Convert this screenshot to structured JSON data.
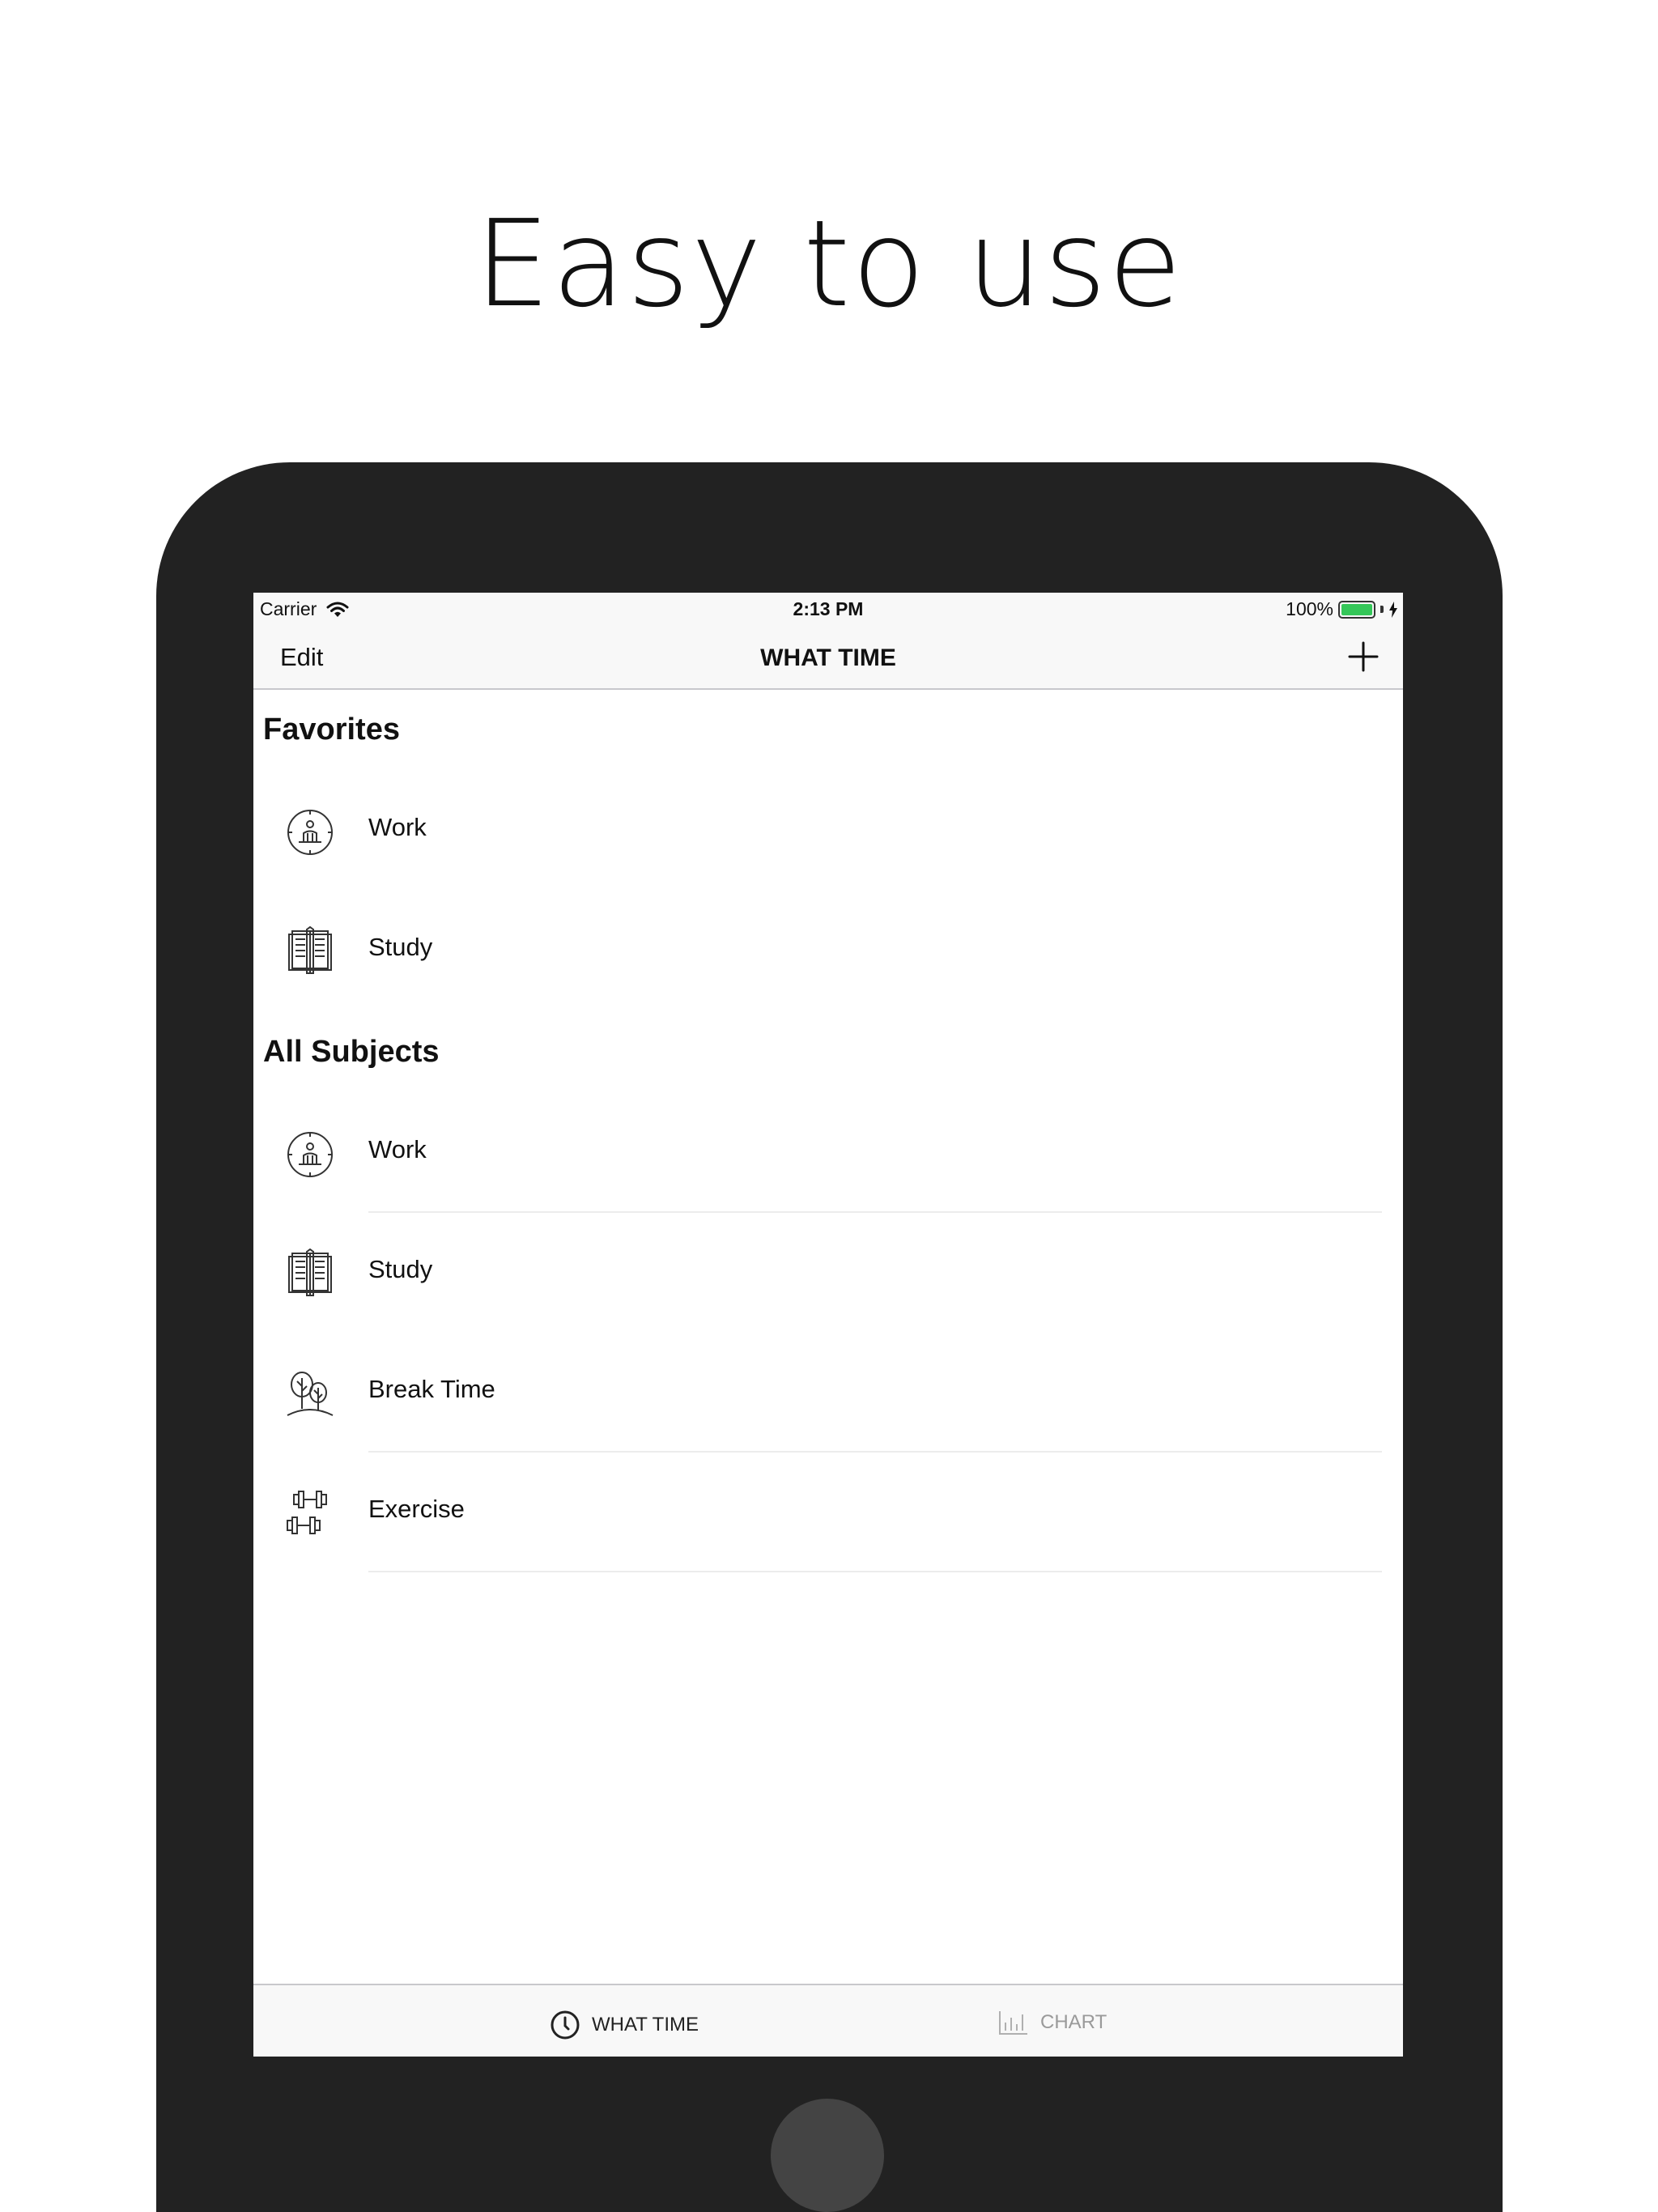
{
  "headline": "Easy to use",
  "status_bar": {
    "carrier": "Carrier",
    "time": "2:13 PM",
    "battery": "100%"
  },
  "nav": {
    "edit_label": "Edit",
    "title": "WHAT TIME",
    "add_icon": "plus-icon"
  },
  "favorites": {
    "header": "Favorites",
    "items": [
      {
        "label": "Work",
        "icon": "clock-person-icon"
      },
      {
        "label": "Study",
        "icon": "book-icon"
      }
    ]
  },
  "all_subjects": {
    "header": "All Subjects",
    "items": [
      {
        "label": "Work",
        "icon": "clock-person-icon"
      },
      {
        "label": "Study",
        "icon": "book-icon"
      },
      {
        "label": "Break Time",
        "icon": "trees-icon"
      },
      {
        "label": "Exercise",
        "icon": "dumbbell-icon"
      }
    ]
  },
  "tabs": [
    {
      "label": "WHAT TIME",
      "icon": "clock-icon",
      "active": true
    },
    {
      "label": "CHART",
      "icon": "bar-chart-icon",
      "active": false
    }
  ],
  "colors": {
    "device": "#222222",
    "battery": "#35c759",
    "bar_background": "#f8f8f8",
    "inactive_tab": "#9a9a9a"
  }
}
